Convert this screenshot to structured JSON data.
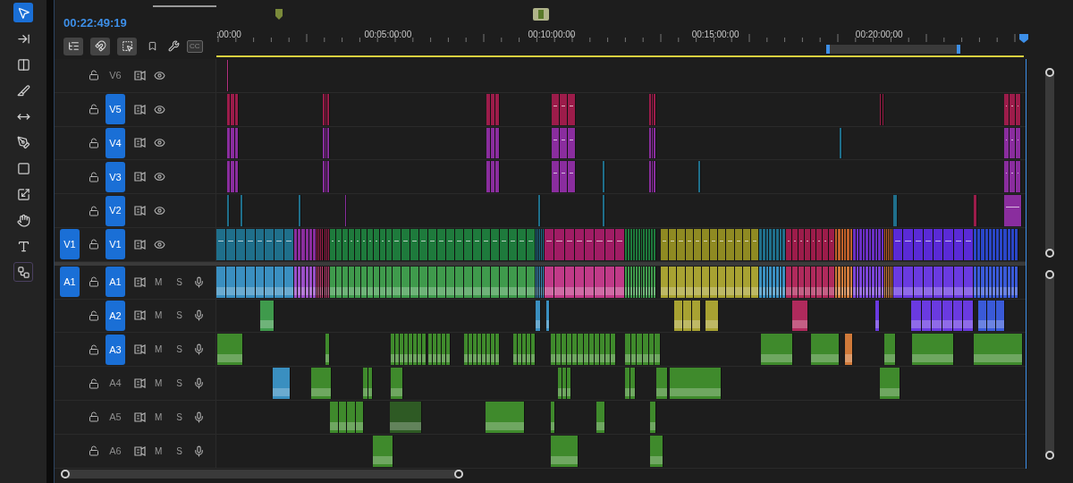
{
  "tools": [
    {
      "kind": "selection",
      "selected": true
    },
    {
      "kind": "track-select",
      "selected": false
    },
    {
      "kind": "ripple",
      "selected": false
    },
    {
      "kind": "razor",
      "selected": false
    },
    {
      "kind": "slip",
      "selected": false
    },
    {
      "kind": "pen",
      "selected": false
    },
    {
      "kind": "rectangle",
      "selected": false
    },
    {
      "kind": "transform",
      "selected": false
    },
    {
      "kind": "hand",
      "selected": false
    },
    {
      "kind": "type",
      "selected": false
    },
    {
      "kind": "nodes",
      "selected": true
    }
  ],
  "timecode": "00:22:49:19",
  "toolbar": {
    "cc_label": "CC"
  },
  "ruler": {
    "labels": [
      ":00:00",
      "00:05:00:00",
      "00:10:00:00",
      "00:15:00:00",
      "00:20:00:00"
    ]
  },
  "video_tracks": [
    {
      "label": "V6",
      "targeted": false
    },
    {
      "label": "V5",
      "targeted": true
    },
    {
      "label": "V4",
      "targeted": true
    },
    {
      "label": "V3",
      "targeted": true
    },
    {
      "label": "V2",
      "targeted": true
    },
    {
      "label": "V1",
      "targeted": true,
      "source_patch": "V1"
    }
  ],
  "audio_tracks": [
    {
      "label": "A1",
      "targeted": true,
      "source_patch": "A1",
      "mute": "M",
      "solo": "S"
    },
    {
      "label": "A2",
      "targeted": true,
      "mute": "M",
      "solo": "S"
    },
    {
      "label": "A3",
      "targeted": true,
      "mute": "M",
      "solo": "S"
    },
    {
      "label": "A4",
      "targeted": false,
      "mute": "M",
      "solo": "S"
    },
    {
      "label": "A5",
      "targeted": false,
      "mute": "M",
      "solo": "S"
    },
    {
      "label": "A6",
      "targeted": false,
      "mute": "M",
      "solo": "S"
    }
  ]
}
